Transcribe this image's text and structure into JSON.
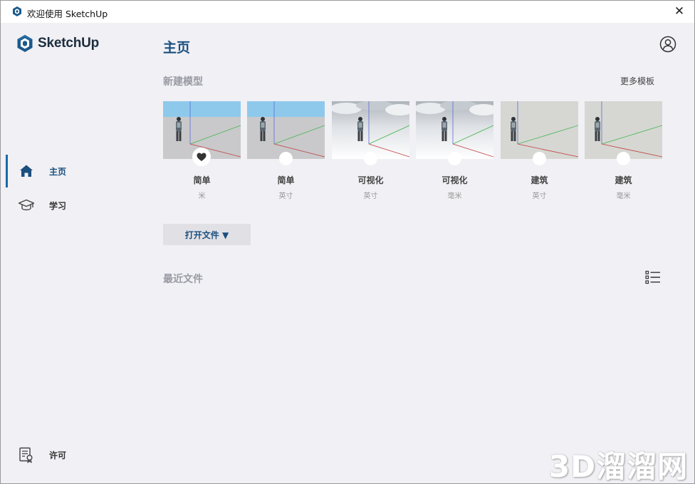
{
  "window": {
    "title": "欢迎使用 SketchUp",
    "close_glyph": "✕"
  },
  "brand": {
    "name": "SketchUp",
    "icon": "sketchup-logo-icon",
    "color": "#1b2c3d"
  },
  "sidebar": {
    "items": [
      {
        "label": "主页",
        "icon": "home-icon",
        "active": true
      },
      {
        "label": "学习",
        "icon": "graduation-cap-icon",
        "active": false
      },
      {
        "label": "许可",
        "icon": "license-icon",
        "active": false
      }
    ]
  },
  "main": {
    "title": "主页",
    "account_icon": "account-icon",
    "new_model": {
      "title": "新建模型",
      "more_label": "更多模板",
      "templates": [
        {
          "name": "简单",
          "unit": "米",
          "sky": "blue",
          "favorite": true
        },
        {
          "name": "简单",
          "unit": "英寸",
          "sky": "blue",
          "favorite": false
        },
        {
          "name": "可视化",
          "unit": "英寸",
          "sky": "clouds",
          "favorite": false
        },
        {
          "name": "可视化",
          "unit": "毫米",
          "sky": "clouds",
          "favorite": false
        },
        {
          "name": "建筑",
          "unit": "英寸",
          "sky": "grey",
          "favorite": false
        },
        {
          "name": "建筑",
          "unit": "毫米",
          "sky": "grey",
          "favorite": false
        }
      ]
    },
    "open_button": {
      "label": "打开文件 ▼"
    },
    "recent": {
      "title": "最近文件",
      "toggle_icon": "list-view-icon"
    }
  },
  "watermark": "3D溜溜网",
  "colors": {
    "accent": "#1a4f7e",
    "background": "#f0f0f5",
    "muted": "#999aa3"
  }
}
